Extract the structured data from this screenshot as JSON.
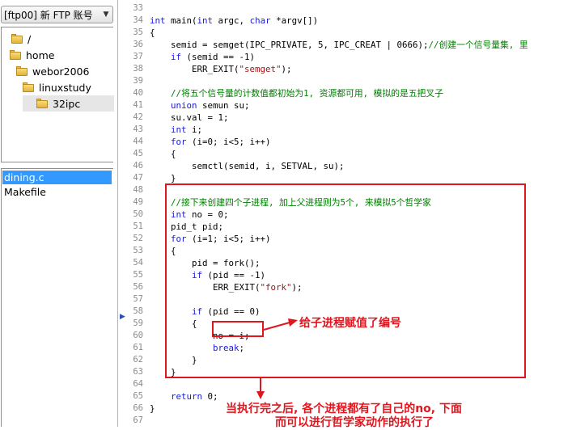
{
  "ftp_selector": {
    "label": "[ftp00] 新 FTP 账号",
    "arrow": "▼"
  },
  "tree": {
    "items": [
      {
        "label": "/",
        "level": 0
      },
      {
        "label": "home",
        "level": 1
      },
      {
        "label": "webor2006",
        "level": 2
      },
      {
        "label": "linuxstudy",
        "level": 3
      },
      {
        "label": "32ipc",
        "level": 4,
        "selected": true
      }
    ]
  },
  "files": {
    "items": [
      {
        "label": "dining.c",
        "selected": true
      },
      {
        "label": "Makefile",
        "selected": false
      }
    ]
  },
  "editor": {
    "line_numbers": [
      "33",
      "34",
      "35",
      "36",
      "37",
      "38",
      "39",
      "40",
      "41",
      "42",
      "43",
      "44",
      "45",
      "46",
      "47",
      "48",
      "49",
      "50",
      "51",
      "52",
      "53",
      "54",
      "55",
      "56",
      "57",
      "58",
      "59",
      "60",
      "61",
      "62",
      "63",
      "64",
      "65",
      "66",
      "67"
    ],
    "lines": [
      [],
      [
        {
          "t": "int",
          "c": "kw"
        },
        {
          "t": " main("
        },
        {
          "t": "int",
          "c": "kw"
        },
        {
          "t": " argc, "
        },
        {
          "t": "char",
          "c": "kw"
        },
        {
          "t": " *argv[])"
        }
      ],
      [
        {
          "t": "{"
        }
      ],
      [
        {
          "t": "    semid = semget(IPC_PRIVATE, 5, IPC_CREAT | 0666);"
        },
        {
          "t": "//创建一个信号量集, 里",
          "c": "cm"
        }
      ],
      [
        {
          "t": "    "
        },
        {
          "t": "if",
          "c": "kw"
        },
        {
          "t": " (semid == -1)"
        }
      ],
      [
        {
          "t": "        ERR_EXIT("
        },
        {
          "t": "\"semget\"",
          "c": "str"
        },
        {
          "t": ");"
        }
      ],
      [],
      [
        {
          "t": "    "
        },
        {
          "t": "//将五个信号量的计数值都初始为1, 资源都可用, 模拟的是五把叉子",
          "c": "cm"
        }
      ],
      [
        {
          "t": "    "
        },
        {
          "t": "union",
          "c": "kw"
        },
        {
          "t": " semun su;"
        }
      ],
      [
        {
          "t": "    su.val = 1;"
        }
      ],
      [
        {
          "t": "    "
        },
        {
          "t": "int",
          "c": "kw"
        },
        {
          "t": " i;"
        }
      ],
      [
        {
          "t": "    "
        },
        {
          "t": "for",
          "c": "kw"
        },
        {
          "t": " (i=0; i<5; i++)"
        }
      ],
      [
        {
          "t": "    {"
        }
      ],
      [
        {
          "t": "        semctl(semid, i, SETVAL, su);"
        }
      ],
      [
        {
          "t": "    }"
        }
      ],
      [],
      [
        {
          "t": "    "
        },
        {
          "t": "//接下来创建四个子进程, 加上父进程则为5个, 来模拟5个哲学家",
          "c": "cm"
        }
      ],
      [
        {
          "t": "    "
        },
        {
          "t": "int",
          "c": "kw"
        },
        {
          "t": " no = 0;"
        }
      ],
      [
        {
          "t": "    pid_t pid;"
        }
      ],
      [
        {
          "t": "    "
        },
        {
          "t": "for",
          "c": "kw"
        },
        {
          "t": " (i=1; i<5; i++)"
        }
      ],
      [
        {
          "t": "    {"
        }
      ],
      [
        {
          "t": "        pid = fork();"
        }
      ],
      [
        {
          "t": "        "
        },
        {
          "t": "if",
          "c": "kw"
        },
        {
          "t": " (pid == -1)"
        }
      ],
      [
        {
          "t": "            ERR_EXIT("
        },
        {
          "t": "\"fork\"",
          "c": "str"
        },
        {
          "t": ");"
        }
      ],
      [],
      [
        {
          "t": "        "
        },
        {
          "t": "if",
          "c": "kw"
        },
        {
          "t": " (pid == 0)"
        }
      ],
      [
        {
          "t": "        {"
        }
      ],
      [
        {
          "t": "            no = i;"
        }
      ],
      [
        {
          "t": "            "
        },
        {
          "t": "break",
          "c": "kw"
        },
        {
          "t": ";"
        }
      ],
      [
        {
          "t": "        }"
        }
      ],
      [
        {
          "t": "    }"
        }
      ],
      [],
      [
        {
          "t": "    "
        },
        {
          "t": "return",
          "c": "kw"
        },
        {
          "t": " 0;"
        }
      ],
      [
        {
          "t": "}"
        }
      ],
      []
    ]
  },
  "annotations": {
    "arrow_label": "给子进程赋值了编号",
    "bottom_line1": "当执行完之后, 各个进程都有了自己的no, 下面",
    "bottom_line2": "而可以进行哲学家动作的执行了"
  },
  "colors": {
    "keyword": "#1a1ad8",
    "string": "#a31515",
    "comment": "#008000",
    "annotation": "#e0161e",
    "selection": "#3399ff"
  }
}
